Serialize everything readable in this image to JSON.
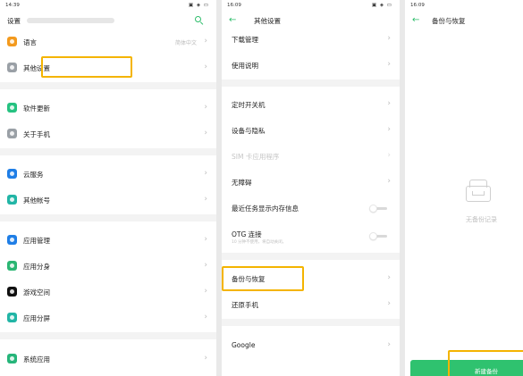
{
  "colors": {
    "accent": "#2ebd6b",
    "highlight": "#f4b400",
    "button": "#2fc26f"
  },
  "screen1": {
    "status": {
      "time": "14:39",
      "icons": "▣ ◈ ▭"
    },
    "title": "设置",
    "items": [
      {
        "label": "语言",
        "value": "简体中文",
        "color": "#f39a1e"
      },
      {
        "label": "其他设置",
        "color": "#9aa0a6"
      },
      {
        "label": "软件更新",
        "color": "#26c281"
      },
      {
        "label": "关于手机",
        "color": "#9aa0a6"
      },
      {
        "label": "云服务",
        "color": "#1f7ee6"
      },
      {
        "label": "其他帐号",
        "color": "#22b5a6"
      },
      {
        "label": "应用管理",
        "color": "#1f7ee6"
      },
      {
        "label": "应用分身",
        "color": "#2bb673"
      },
      {
        "label": "游戏空间",
        "color": "#111111"
      },
      {
        "label": "应用分屏",
        "color": "#22b5a6"
      },
      {
        "label": "系统应用",
        "color": "#26b57a"
      }
    ]
  },
  "screen2": {
    "status": {
      "time": "16:09",
      "icons": "▣ ◈ ▭"
    },
    "title": "其他设置",
    "items": [
      {
        "label": "下载管理"
      },
      {
        "label": "使用说明"
      },
      {
        "label": "定时开关机"
      },
      {
        "label": "设备与隐私"
      },
      {
        "label": "SIM 卡应用程序"
      },
      {
        "label": "无障碍"
      },
      {
        "label": "最近任务显示内存信息"
      },
      {
        "label": "OTG 连接",
        "sub": "10 分钟不使用，将自动关闭。"
      },
      {
        "label": "备份与恢复"
      },
      {
        "label": "还原手机"
      },
      {
        "label": "Google"
      }
    ]
  },
  "screen3": {
    "status": {
      "time": "16:09"
    },
    "title": "备份与恢复",
    "empty_text": "无备份记录",
    "new_backup_label": "新建备份"
  }
}
